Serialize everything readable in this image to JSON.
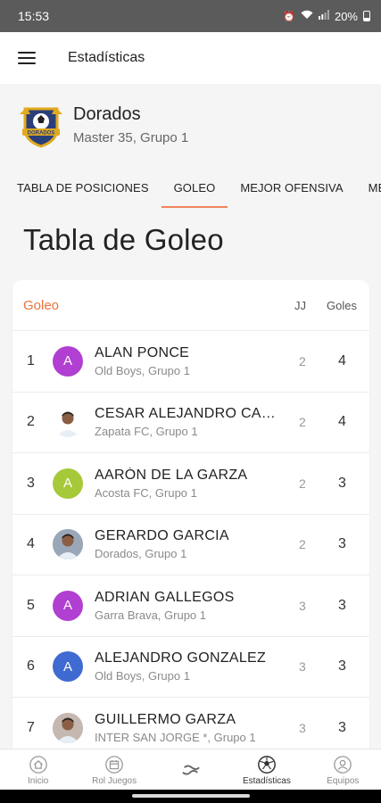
{
  "status_bar": {
    "time": "15:53",
    "battery": "20%"
  },
  "app_bar": {
    "title": "Estadísticas"
  },
  "team": {
    "name": "Dorados",
    "subtitle": "Master 35, Grupo 1",
    "crest_text": "DORADOS"
  },
  "tabs": [
    {
      "label": "TABLA DE POSICIONES",
      "active": false
    },
    {
      "label": "GOLEO",
      "active": true
    },
    {
      "label": "MEJOR OFENSIVA",
      "active": false
    },
    {
      "label": "MEJ",
      "active": false
    }
  ],
  "page_heading": "Tabla de Goleo",
  "card": {
    "title": "Goleo",
    "col_jj": "JJ",
    "col_goles": "Goles",
    "rows": [
      {
        "rank": "1",
        "name": "ALAN PONCE",
        "team": "Old Boys, Grupo 1",
        "jj": "2",
        "goles": "4",
        "initial": "A",
        "avatar_color": "#b13fd1",
        "photo": false
      },
      {
        "rank": "2",
        "name": "CESAR ALEJANDRO CASTAÑEDA",
        "team": "Zapata FC, Grupo 1",
        "jj": "2",
        "goles": "4",
        "initial": "",
        "avatar_color": "#ffffff",
        "photo": true
      },
      {
        "rank": "3",
        "name": "AARÓN DE LA GARZA",
        "team": "Acosta FC, Grupo 1",
        "jj": "2",
        "goles": "3",
        "initial": "A",
        "avatar_color": "#a6c93a",
        "photo": false
      },
      {
        "rank": "4",
        "name": "GERARDO GARCIA",
        "team": "Dorados, Grupo 1",
        "jj": "2",
        "goles": "3",
        "initial": "",
        "avatar_color": "#9aa7b8",
        "photo": true
      },
      {
        "rank": "5",
        "name": "ADRIAN GALLEGOS",
        "team": "Garra Brava, Grupo 1",
        "jj": "3",
        "goles": "3",
        "initial": "A",
        "avatar_color": "#b13fd1",
        "photo": false
      },
      {
        "rank": "6",
        "name": "ALEJANDRO GONZALEZ",
        "team": "Old Boys, Grupo 1",
        "jj": "3",
        "goles": "3",
        "initial": "A",
        "avatar_color": "#3f6ad1",
        "photo": false
      },
      {
        "rank": "7",
        "name": "GUILLERMO GARZA",
        "team": "INTER SAN JORGE *, Grupo 1",
        "jj": "3",
        "goles": "3",
        "initial": "",
        "avatar_color": "#c4b8b0",
        "photo": true
      }
    ]
  },
  "bottom_nav": [
    {
      "label": "Inicio",
      "icon": "home-icon",
      "active": false
    },
    {
      "label": "Rol Juegos",
      "icon": "calendar-icon",
      "active": false
    },
    {
      "label": "",
      "icon": "app-logo-icon",
      "active": false
    },
    {
      "label": "Estadísticas",
      "icon": "stats-ball-icon",
      "active": true
    },
    {
      "label": "Equipos",
      "icon": "team-icon",
      "active": false
    }
  ]
}
